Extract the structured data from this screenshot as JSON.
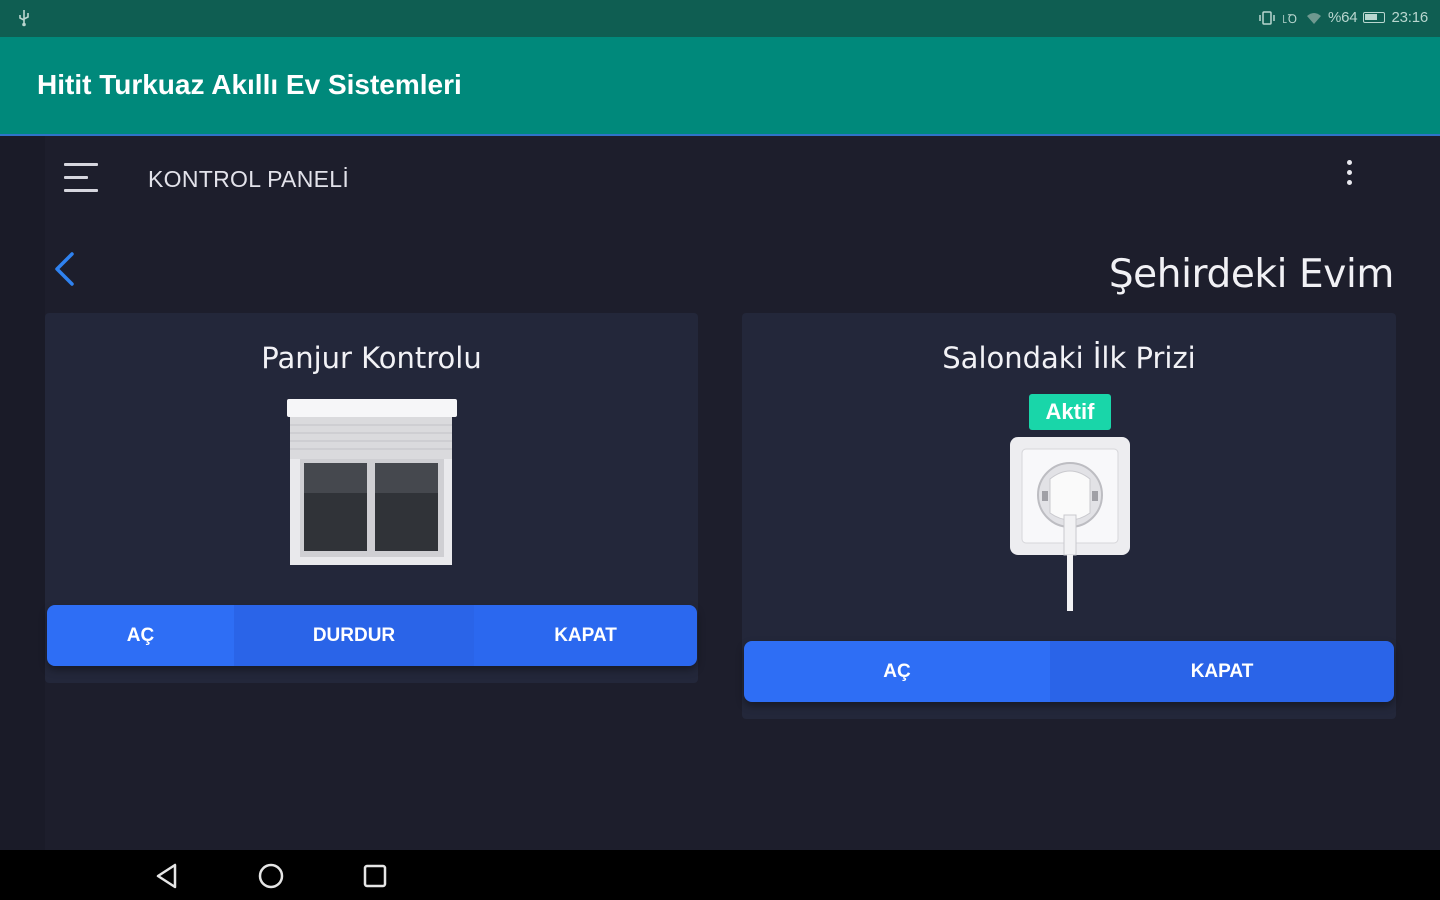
{
  "status_bar": {
    "signal_text": "%64",
    "time": "23:16"
  },
  "app_bar": {
    "title": "Hitit Turkuaz Akıllı Ev Sistemleri"
  },
  "toolbar": {
    "title": "KONTROL PANELİ",
    "menu_icon": "hamburger-menu-icon",
    "more_icon": "more-vertical-icon"
  },
  "home": {
    "back_icon": "chevron-left-icon",
    "name": "Şehirdeki Evim"
  },
  "cards": [
    {
      "title": "Panjur Kontrolu",
      "icon": "roller-shutter-icon",
      "buttons": [
        "AÇ",
        "DURDUR",
        "KAPAT"
      ]
    },
    {
      "title": "Salondaki İlk Prizi",
      "status_badge": "Aktif",
      "icon": "power-socket-icon",
      "buttons": [
        "AÇ",
        "KAPAT"
      ]
    }
  ],
  "nav_bar": {
    "icons": [
      "back-triangle-icon",
      "home-circle-icon",
      "recents-square-icon"
    ]
  },
  "colors": {
    "status_bar": "#0f5e52",
    "app_bar": "#00897b",
    "background": "#1d1e2c",
    "card": "#23273a",
    "button": "#2e6ef5",
    "badge": "#19d6a9"
  }
}
